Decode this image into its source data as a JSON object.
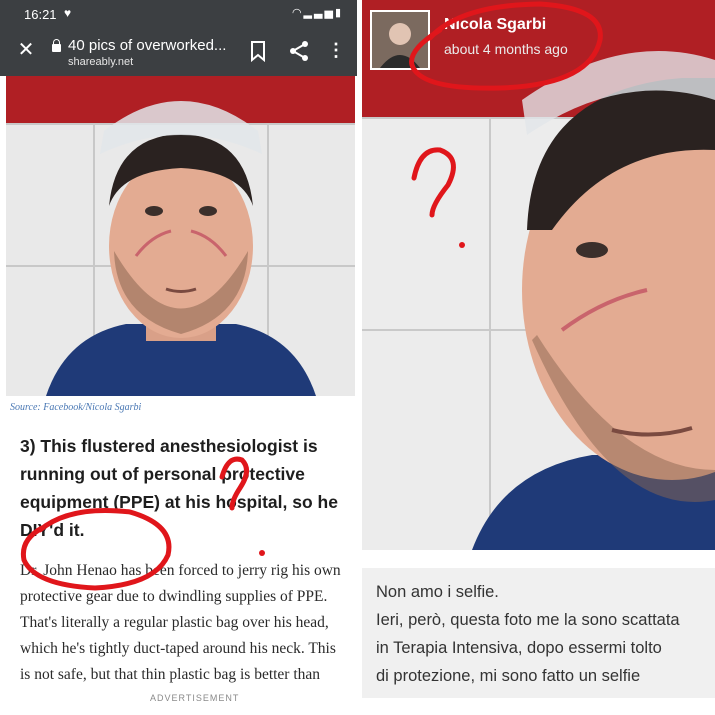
{
  "status_bar": {
    "time": "16:21"
  },
  "browser": {
    "page_title": "40 pics of overworked...",
    "domain": "shareably.net"
  },
  "article": {
    "source": "Source: Facebook/Nicola Sgarbi",
    "heading": "3) This flustered anesthesiologist is running out of personal protective equipment (PPE) at his hospital, so he DIY'd it.",
    "body": "Dr. John Henao has been forced to jerry rig his own protective gear due to dwindling supplies of PPE. That's literally a regular plastic bag over his head, which he's tightly duct-taped around his neck. This is not safe, but that thin plastic bag is better than",
    "ad_label": "ADVERTISEMENT"
  },
  "facebook_post": {
    "author": "Nicola Sgarbi",
    "time": "about 4 months ago",
    "caption_lines": [
      "Non amo i selfie.",
      "Ieri, però, questa foto me la sono scattata",
      "in Terapia Intensiva, dopo essermi tolto",
      "di protezione, mi sono fatto un selfie"
    ]
  },
  "colors": {
    "toolbar": "#3c3f42",
    "annotation_red": "#e0161b",
    "source_link": "#4a78b4",
    "scrub_top": "#1f3a78",
    "tile_red": "#b01f24"
  },
  "icons": [
    "close-icon",
    "lock-icon",
    "bookmark-icon",
    "share-icon",
    "more-icon",
    "heart-icon",
    "wifi-icon",
    "signal-icon",
    "battery-icon"
  ]
}
